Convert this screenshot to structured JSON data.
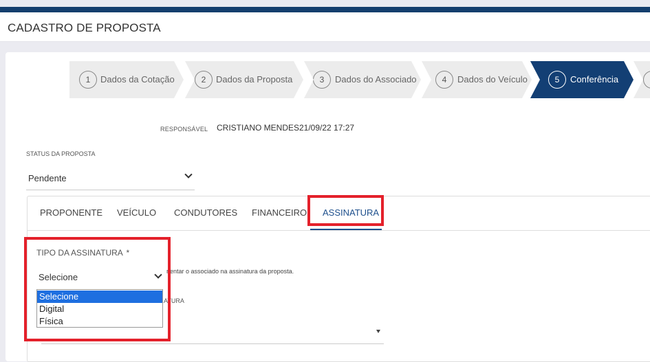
{
  "header": {
    "title": "CADASTRO DE PROPOSTA"
  },
  "stepper": {
    "steps": [
      {
        "num": "1",
        "label": "Dados da Cotação"
      },
      {
        "num": "2",
        "label": "Dados da Proposta"
      },
      {
        "num": "3",
        "label": "Dados do Associado"
      },
      {
        "num": "4",
        "label": "Dados do Veículo"
      },
      {
        "num": "5",
        "label": "Conferência"
      }
    ],
    "active_step": 5
  },
  "responsible": {
    "label": "RESPONSÁVEL",
    "name": "CRISTIANO MENDES",
    "datetime": "21/09/22 17:27"
  },
  "status": {
    "label": "STATUS DA PROPOSTA",
    "value": "Pendente"
  },
  "tabs": [
    {
      "label": "PROPONENTE"
    },
    {
      "label": "VEÍCULO"
    },
    {
      "label": "CONDUTORES"
    },
    {
      "label": "FINANCEIRO"
    },
    {
      "label": "ASSINATURA"
    }
  ],
  "active_tab": "ASSINATURA",
  "signature": {
    "type_label": "TIPO DA ASSINATURA",
    "required_mark": "*",
    "selected": "Selecione",
    "hint": "rientar o associado na assinatura da proposta.",
    "second_label_fragment": "ATURA",
    "options": [
      "Selecione",
      "Digital",
      "Física"
    ]
  },
  "colors": {
    "brand": "#153f6e",
    "active_step": "#133f74",
    "highlight": "#e4212b",
    "option_selected": "#1e6fe0"
  }
}
